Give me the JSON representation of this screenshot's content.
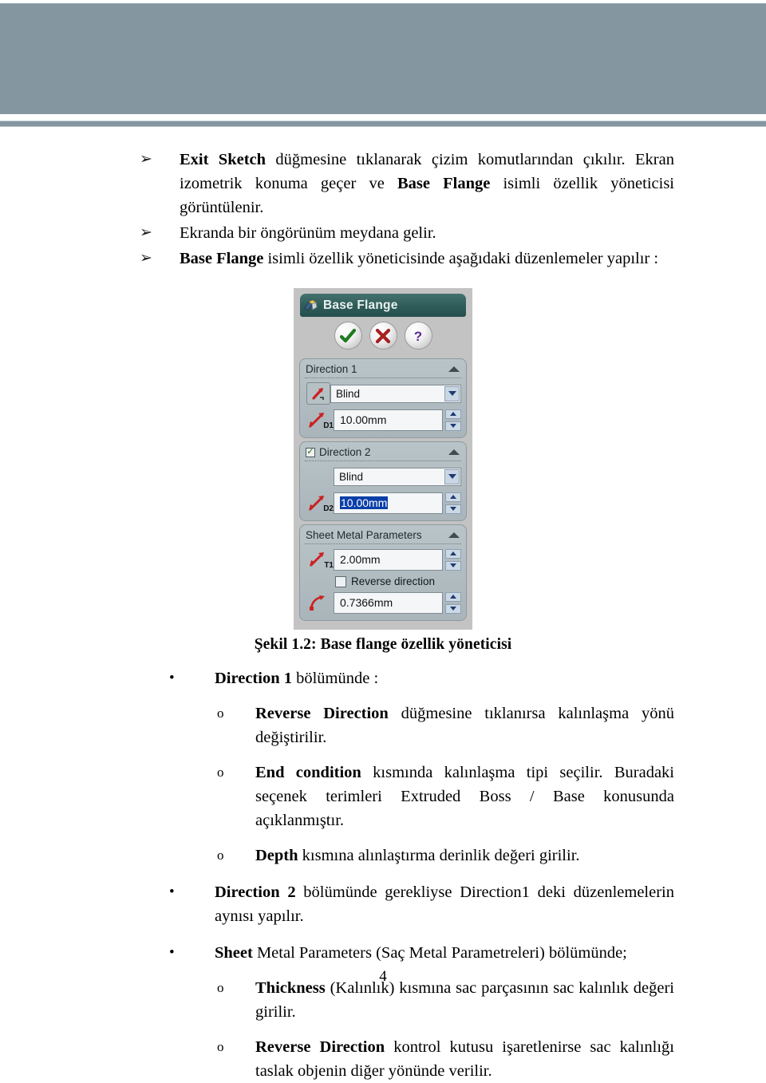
{
  "header": {
    "banner_color": "#8496a0"
  },
  "intro_list": [
    {
      "marker": "➢",
      "segments": [
        {
          "text": "Exit Sketch",
          "bold": true
        },
        {
          "text": " düğmesine tıklanarak çizim komutlarından çıkılır. Ekran izometrik konuma geçer ve ",
          "bold": false
        },
        {
          "text": "Base Flange",
          "bold": true
        },
        {
          "text": " isimli özellik yöneticisi  görüntülenir.",
          "bold": false
        }
      ]
    },
    {
      "marker": "➢",
      "segments": [
        {
          "text": "Ekranda bir öngörünüm meydana gelir.",
          "bold": false
        }
      ]
    },
    {
      "marker": "➢",
      "segments": [
        {
          "text": "Base Flange",
          "bold": true
        },
        {
          "text": " isimli özellik yöneticisinde aşağıdaki düzenlemeler yapılır :",
          "bold": false
        }
      ]
    }
  ],
  "figure": {
    "caption": "Şekil 1.2: Base flange özellik yöneticisi",
    "property_manager": {
      "title": "Base Flange",
      "title_icon": "sheet-metal-flange-icon",
      "tools": [
        {
          "name": "ok-button",
          "glyph": "✔",
          "color": "#1f7a1f"
        },
        {
          "name": "cancel-button",
          "glyph": "✖",
          "color": "#a81f1f"
        },
        {
          "name": "help-button",
          "glyph": "?",
          "color": "#5b2d91"
        }
      ],
      "groups": [
        {
          "name": "direction-1",
          "title": "Direction 1",
          "has_checkbox": false,
          "checked": false,
          "end_condition": "Blind",
          "depth_label": "D1",
          "depth_value": "10.00mm",
          "depth_selected": false
        },
        {
          "name": "direction-2",
          "title": "Direction 2",
          "has_checkbox": true,
          "checked": true,
          "end_condition": "Blind",
          "depth_label": "D2",
          "depth_value": "10.00mm",
          "depth_selected": true
        }
      ],
      "sheet_metal": {
        "title": "Sheet Metal Parameters",
        "thickness_label": "T1",
        "thickness_value": "2.00mm",
        "reverse_direction_label": "Reverse direction",
        "reverse_direction_checked": false,
        "bend_radius_value": "0.7366mm"
      }
    }
  },
  "detail_list": [
    {
      "level": 1,
      "marker": "•",
      "justify": false,
      "segments": [
        {
          "text": "Direction 1",
          "bold": true
        },
        {
          "text": " bölümünde :",
          "bold": false
        }
      ]
    },
    {
      "level": 2,
      "marker": "o",
      "justify": true,
      "segments": [
        {
          "text": "Reverse Direction",
          "bold": true
        },
        {
          "text": " düğmesine tıklanırsa kalınlaşma yönü değiştirilir.",
          "bold": false
        }
      ]
    },
    {
      "level": 2,
      "marker": "o",
      "justify": true,
      "segments": [
        {
          "text": "End condition",
          "bold": true
        },
        {
          "text": " kısmında kalınlaşma tipi seçilir. Buradaki seçenek terimleri Extruded Boss / Base konusunda açıklanmıştır.",
          "bold": false
        }
      ]
    },
    {
      "level": 2,
      "marker": "o",
      "justify": false,
      "segments": [
        {
          "text": "Depth",
          "bold": true
        },
        {
          "text": " kısmına alınlaştırma derinlik değeri girilir.",
          "bold": false
        }
      ]
    },
    {
      "level": 1,
      "marker": "•",
      "justify": true,
      "segments": [
        {
          "text": "Direction 2",
          "bold": true
        },
        {
          "text": " bölümünde gerekliyse Direction1 deki düzenlemelerin aynısı yapılır.",
          "bold": false
        }
      ]
    },
    {
      "level": 1,
      "marker": "•",
      "justify": false,
      "segments": [
        {
          "text": "Sheet",
          "bold": true
        },
        {
          "text": " Metal Parameters (Saç Metal Parametreleri) bölümünde;",
          "bold": false
        }
      ]
    },
    {
      "level": 2,
      "marker": "o",
      "justify": true,
      "segments": [
        {
          "text": "Thickness",
          "bold": true
        },
        {
          "text": " (Kalınlık) kısmına sac parçasının sac kalınlık değeri girilir.",
          "bold": false
        }
      ]
    },
    {
      "level": 2,
      "marker": "o",
      "justify": true,
      "segments": [
        {
          "text": "Reverse Direction",
          "bold": true
        },
        {
          "text": " kontrol kutusu işaretlenirse sac kalınlığı taslak objenin diğer yönünde verilir.",
          "bold": false
        }
      ]
    }
  ],
  "page_number": "4"
}
